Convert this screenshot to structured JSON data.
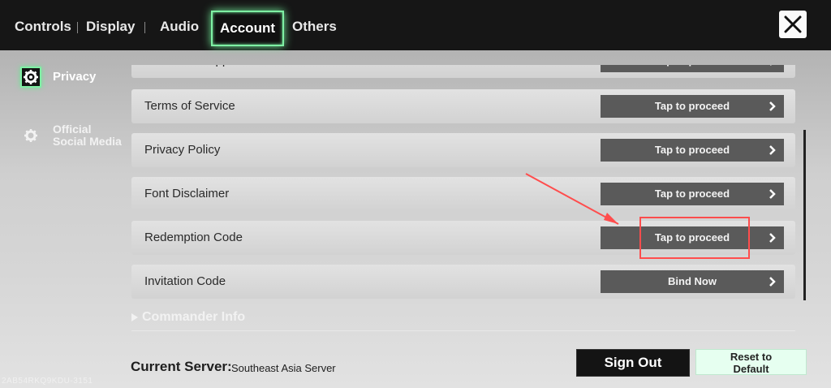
{
  "tabs": [
    {
      "label": "Controls",
      "active": false
    },
    {
      "label": "Display",
      "active": false
    },
    {
      "label": "Audio",
      "active": false
    },
    {
      "label": "Account",
      "active": true
    },
    {
      "label": "Others",
      "active": false
    }
  ],
  "close_icon": "close-x-icon",
  "sidebar": {
    "items": [
      {
        "label": "Privacy",
        "icon": "gear-icon",
        "active": true
      },
      {
        "label_line1": "Official",
        "label_line2": "Social Media",
        "icon": "gear-icon",
        "active": false
      }
    ]
  },
  "rows": [
    {
      "label": "Customer Support",
      "action": "Tap to proceed"
    },
    {
      "label": "Terms of Service",
      "action": "Tap to proceed"
    },
    {
      "label": "Privacy Policy",
      "action": "Tap to proceed"
    },
    {
      "label": "Font Disclaimer",
      "action": "Tap to proceed"
    },
    {
      "label": "Redemption Code",
      "action": "Tap to proceed"
    },
    {
      "label": "Invitation Code",
      "action": "Bind Now"
    }
  ],
  "commander_info": "Commander Info",
  "footer": {
    "server_label": "Current Server:",
    "server_value": "Southeast Asia Server",
    "sign_out": "Sign Out",
    "reset_line1": "Reset to",
    "reset_line2": "Default",
    "build_id": "2AB54RKQ9KDU-3151"
  },
  "colors": {
    "accent": "#7ff0a4",
    "annotation": "#ff4d4d",
    "topbar": "#161616",
    "action_button": "#5a5a5a"
  }
}
